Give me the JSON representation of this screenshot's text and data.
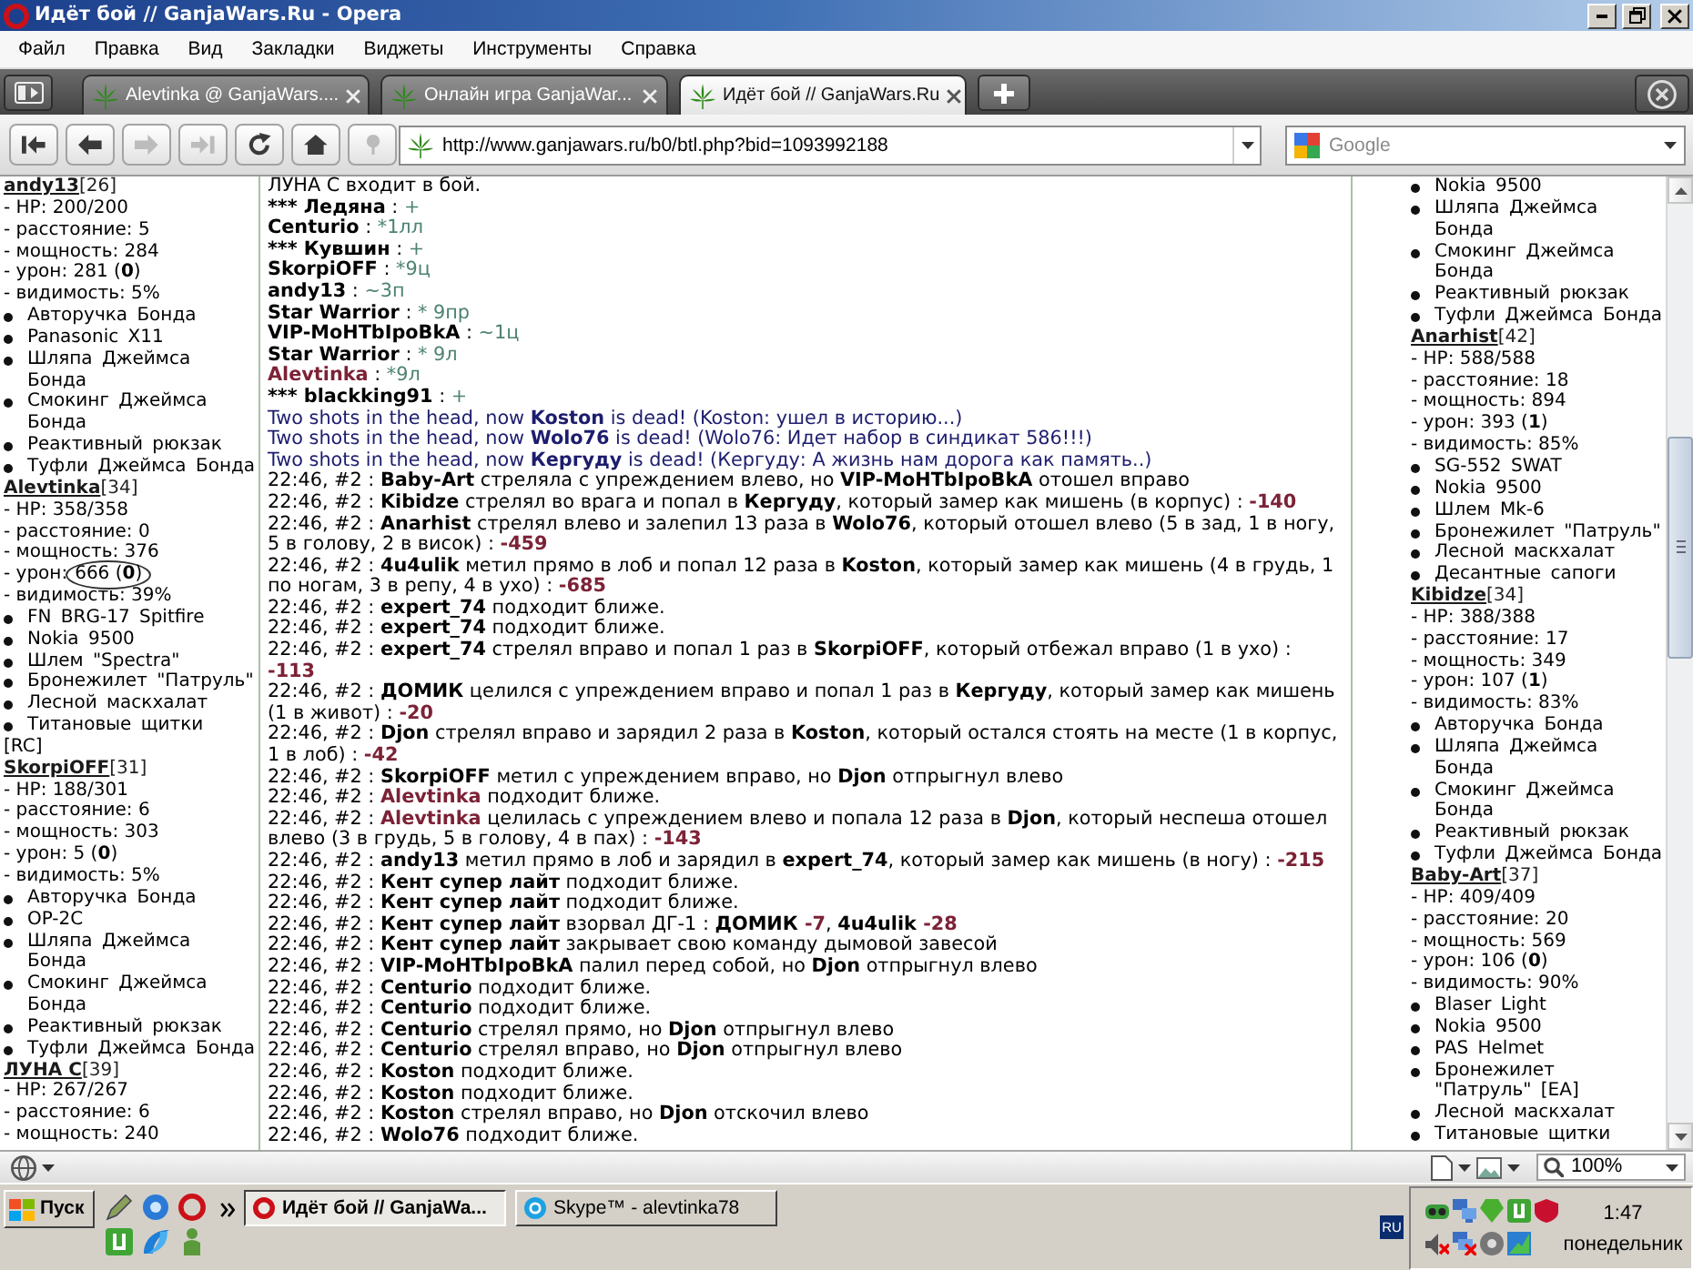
{
  "window": {
    "title": "Идёт бой // GanjaWars.Ru - Opera"
  },
  "menu": [
    "Файл",
    "Правка",
    "Вид",
    "Закладки",
    "Виджеты",
    "Инструменты",
    "Справка"
  ],
  "tabs": [
    {
      "label": "Alevtinka @ GanjaWars....",
      "selected": false
    },
    {
      "label": "Онлайн игра GanjaWar...",
      "selected": false
    },
    {
      "label": "Идёт бой // GanjaWars.Ru",
      "selected": true
    }
  ],
  "nav_buttons": [
    {
      "disabled": false
    },
    {
      "disabled": false
    },
    {
      "disabled": true
    },
    {
      "disabled": true
    },
    {
      "disabled": false
    },
    {
      "disabled": false
    },
    {
      "disabled": true
    }
  ],
  "address_bar": {
    "url": "http://www.ganjawars.ru/b0/btl.php?bid=1093992188"
  },
  "search": {
    "placeholder": "Google"
  },
  "left_team": [
    {
      "name": "andy13",
      "level": "[26]",
      "hp": "- HP: 200/200",
      "distance": "- расстояние: 5",
      "power": "- мощность: 284",
      "damage": {
        "label": "- урон:",
        "value": "281 (**0**)",
        "circled": false
      },
      "visibility": "- видимость: 5%",
      "items": [
        "Авторучка Бонда",
        "Panasonic X11",
        "Шляпа Джеймса Бонда",
        "Смокинг Джеймса Бонда",
        "Реактивный рюкзак",
        "Туфли Джеймса Бонда"
      ]
    },
    {
      "name": "Alevtinka",
      "level": "[34]",
      "hp": "- HP: 358/358",
      "distance": "- расстояние: 0",
      "power": "- мощность: 376",
      "damage": {
        "label": "- урон:",
        "value": "666 (**0**)",
        "circled": true
      },
      "visibility": "- видимость: 39%",
      "items": [
        "FN BRG-17 Spitfire",
        "Nokia 9500",
        "Шлем \"Spectra\"",
        "Бронежилет \"Патруль\"",
        "Лесной маскхалат",
        "Титановые щитки"
      ],
      "tag": "[RC]"
    },
    {
      "name": "SkorpiOFF",
      "level": "[31]",
      "hp": "- HP: 188/301",
      "distance": "- расстояние: 6",
      "power": "- мощность: 303",
      "damage": {
        "label": "- урон:",
        "value": "5 (**0**)",
        "circled": false
      },
      "visibility": "- видимость: 5%",
      "items": [
        "Авторучка Бонда",
        "OP-2C",
        "Шляпа Джеймса Бонда",
        "Смокинг Джеймса Бонда",
        "Реактивный рюкзак",
        "Туфли Джеймса Бонда"
      ]
    },
    {
      "name": "ЛУНА С",
      "level": "[39]",
      "hp": "- HP: 267/267",
      "distance": "- расстояние: 6",
      "power": "- мощность: 240"
    }
  ],
  "battle_log": [
    {
      "kind": "event",
      "segments": [
        {
          "kind": "plain",
          "text": "ЛУНА С входит в бой."
        }
      ]
    },
    {
      "kind": "chat",
      "segments": [
        {
          "kind": "name",
          "text": "*** Ледяна"
        },
        {
          "kind": "plain",
          "text": " : "
        },
        {
          "kind": "message",
          "text": "+"
        }
      ]
    },
    {
      "kind": "chat",
      "segments": [
        {
          "kind": "name",
          "text": "Centurio"
        },
        {
          "kind": "plain",
          "text": " : "
        },
        {
          "kind": "message",
          "text": "*1лл"
        }
      ]
    },
    {
      "kind": "chat",
      "segments": [
        {
          "kind": "name",
          "text": "*** Кувшин"
        },
        {
          "kind": "plain",
          "text": " : "
        },
        {
          "kind": "message",
          "text": "+"
        }
      ]
    },
    {
      "kind": "chat",
      "segments": [
        {
          "kind": "name",
          "text": "SkorpiOFF"
        },
        {
          "kind": "plain",
          "text": " : "
        },
        {
          "kind": "message",
          "text": "*9ц"
        }
      ]
    },
    {
      "kind": "chat",
      "segments": [
        {
          "kind": "name",
          "text": "andy13"
        },
        {
          "kind": "plain",
          "text": " : "
        },
        {
          "kind": "message",
          "text": "~3п"
        }
      ]
    },
    {
      "kind": "chat",
      "segments": [
        {
          "kind": "name",
          "text": "Star Warrior"
        },
        {
          "kind": "plain",
          "text": " : "
        },
        {
          "kind": "message",
          "text": "* 9пр"
        }
      ]
    },
    {
      "kind": "chat",
      "segments": [
        {
          "kind": "name",
          "text": "VIP-MoHTbIpoBkA"
        },
        {
          "kind": "plain",
          "text": " : "
        },
        {
          "kind": "message",
          "text": "~1ц"
        }
      ]
    },
    {
      "kind": "chat",
      "segments": [
        {
          "kind": "name",
          "text": "Star Warrior"
        },
        {
          "kind": "plain",
          "text": " : "
        },
        {
          "kind": "message",
          "text": "* 9л"
        }
      ]
    },
    {
      "kind": "chat",
      "segments": [
        {
          "kind": "own",
          "text": "Alevtinka"
        },
        {
          "kind": "plain",
          "text": " : "
        },
        {
          "kind": "message",
          "text": "*9л"
        }
      ]
    },
    {
      "kind": "chat",
      "segments": [
        {
          "kind": "name",
          "text": "*** blackking91"
        },
        {
          "kind": "plain",
          "text": " : "
        },
        {
          "kind": "message",
          "text": "+"
        }
      ]
    },
    {
      "kind": "death",
      "segments": [
        {
          "kind": "plain",
          "text": "Two shots in the head, now "
        },
        {
          "kind": "name",
          "text": "Koston"
        },
        {
          "kind": "plain",
          "text": " is dead! (Koston: ушел в историю...)"
        }
      ]
    },
    {
      "kind": "death",
      "segments": [
        {
          "kind": "plain",
          "text": "Two shots in the head, now "
        },
        {
          "kind": "name",
          "text": "Wolo76"
        },
        {
          "kind": "plain",
          "text": " is dead! (Wolo76: Идет набор в синдикат 586!!!)"
        }
      ]
    },
    {
      "kind": "death",
      "segments": [
        {
          "kind": "plain",
          "text": "Two shots in the head, now "
        },
        {
          "kind": "name",
          "text": "Кергуду"
        },
        {
          "kind": "plain",
          "text": " is dead! (Кергуду: А жизнь нам дорога как память..)"
        }
      ]
    },
    {
      "kind": "event",
      "segments": [
        {
          "kind": "plain",
          "text": "22:46, #2 : "
        },
        {
          "kind": "name",
          "text": "Baby-Art"
        },
        {
          "kind": "plain",
          "text": " стреляла с упреждением влево, но "
        },
        {
          "kind": "name",
          "text": "VIP-MoHTbIpoBkA"
        },
        {
          "kind": "plain",
          "text": " отошел вправо"
        }
      ]
    },
    {
      "kind": "event",
      "segments": [
        {
          "kind": "plain",
          "text": "22:46, #2 : "
        },
        {
          "kind": "name",
          "text": "Kibidze"
        },
        {
          "kind": "plain",
          "text": " стрелял во врага и попал в "
        },
        {
          "kind": "name",
          "text": "Кергуду"
        },
        {
          "kind": "plain",
          "text": ", который замер как мишень (в корпус) : "
        },
        {
          "kind": "damage",
          "text": "-140"
        }
      ]
    },
    {
      "kind": "event",
      "segments": [
        {
          "kind": "plain",
          "text": "22:46, #2 : "
        },
        {
          "kind": "name",
          "text": "Anarhist"
        },
        {
          "kind": "plain",
          "text": " стрелял влево и залепил 13 раза в "
        },
        {
          "kind": "name",
          "text": "Wolo76"
        },
        {
          "kind": "plain",
          "text": ", который отошел влево (5 в зад, 1 в ногу, 5 в голову, 2 в висок) : "
        },
        {
          "kind": "damage",
          "text": "-459"
        }
      ]
    },
    {
      "kind": "event",
      "segments": [
        {
          "kind": "plain",
          "text": "22:46, #2 : "
        },
        {
          "kind": "name",
          "text": "4u4ulik"
        },
        {
          "kind": "plain",
          "text": " метил прямо в лоб и попал 12 раза в "
        },
        {
          "kind": "name",
          "text": "Koston"
        },
        {
          "kind": "plain",
          "text": ", который замер как мишень (4 в грудь, 1 по ногам, 3 в репу, 4 в ухо) : "
        },
        {
          "kind": "damage",
          "text": "-685"
        }
      ]
    },
    {
      "kind": "event",
      "segments": [
        {
          "kind": "plain",
          "text": "22:46, #2 : "
        },
        {
          "kind": "name",
          "text": "expert_74"
        },
        {
          "kind": "plain",
          "text": " подходит ближе."
        }
      ]
    },
    {
      "kind": "event",
      "segments": [
        {
          "kind": "plain",
          "text": "22:46, #2 : "
        },
        {
          "kind": "name",
          "text": "expert_74"
        },
        {
          "kind": "plain",
          "text": " подходит ближе."
        }
      ]
    },
    {
      "kind": "event",
      "segments": [
        {
          "kind": "plain",
          "text": "22:46, #2 : "
        },
        {
          "kind": "name",
          "text": "expert_74"
        },
        {
          "kind": "plain",
          "text": " стрелял вправо и попал 1 раз в "
        },
        {
          "kind": "name",
          "text": "SkorpiOFF"
        },
        {
          "kind": "plain",
          "text": ", который отбежал вправо (1 в ухо) : "
        },
        {
          "kind": "damage",
          "text": "-113"
        }
      ]
    },
    {
      "kind": "event",
      "segments": [
        {
          "kind": "plain",
          "text": "22:46, #2 : "
        },
        {
          "kind": "name",
          "text": "ДОМИК"
        },
        {
          "kind": "plain",
          "text": " целился с упреждением вправо и попал 1 раз в "
        },
        {
          "kind": "name",
          "text": "Кергуду"
        },
        {
          "kind": "plain",
          "text": ", который замер как мишень (1 в живот) : "
        },
        {
          "kind": "damage",
          "text": "-20"
        }
      ]
    },
    {
      "kind": "event",
      "segments": [
        {
          "kind": "plain",
          "text": "22:46, #2 : "
        },
        {
          "kind": "name",
          "text": "Djon"
        },
        {
          "kind": "plain",
          "text": " стрелял вправо и зарядил 2 раза в "
        },
        {
          "kind": "name",
          "text": "Koston"
        },
        {
          "kind": "plain",
          "text": ", который остался стоять на месте (1 в корпус, 1 в лоб) : "
        },
        {
          "kind": "damage",
          "text": "-42"
        }
      ]
    },
    {
      "kind": "event",
      "segments": [
        {
          "kind": "plain",
          "text": "22:46, #2 : "
        },
        {
          "kind": "name",
          "text": "SkorpiOFF"
        },
        {
          "kind": "plain",
          "text": " метил с упреждением вправо, но "
        },
        {
          "kind": "name",
          "text": "Djon"
        },
        {
          "kind": "plain",
          "text": " отпрыгнул влево"
        }
      ]
    },
    {
      "kind": "event",
      "segments": [
        {
          "kind": "plain",
          "text": "22:46, #2 : "
        },
        {
          "kind": "own",
          "text": "Alevtinka"
        },
        {
          "kind": "plain",
          "text": " подходит ближе."
        }
      ]
    },
    {
      "kind": "event",
      "segments": [
        {
          "kind": "plain",
          "text": "22:46, #2 : "
        },
        {
          "kind": "own",
          "text": "Alevtinka"
        },
        {
          "kind": "plain",
          "text": " целилась с упреждением влево и попала 12 раза в "
        },
        {
          "kind": "name",
          "text": "Djon"
        },
        {
          "kind": "plain",
          "text": ", который неспеша отошел влево (3 в грудь, 5 в голову, 4 в пах) : "
        },
        {
          "kind": "damage",
          "text": "-143"
        }
      ]
    },
    {
      "kind": "event",
      "segments": [
        {
          "kind": "plain",
          "text": "22:46, #2 : "
        },
        {
          "kind": "name",
          "text": "andy13"
        },
        {
          "kind": "plain",
          "text": " метил прямо в лоб и зарядил в "
        },
        {
          "kind": "name",
          "text": "expert_74"
        },
        {
          "kind": "plain",
          "text": ", который замер как мишень (в ногу) : "
        },
        {
          "kind": "damage",
          "text": "-215"
        }
      ]
    },
    {
      "kind": "event",
      "segments": [
        {
          "kind": "plain",
          "text": "22:46, #2 : "
        },
        {
          "kind": "name",
          "text": "Кент супер лайт"
        },
        {
          "kind": "plain",
          "text": " подходит ближе."
        }
      ]
    },
    {
      "kind": "event",
      "segments": [
        {
          "kind": "plain",
          "text": "22:46, #2 : "
        },
        {
          "kind": "name",
          "text": "Кент супер лайт"
        },
        {
          "kind": "plain",
          "text": " подходит ближе."
        }
      ]
    },
    {
      "kind": "event",
      "segments": [
        {
          "kind": "plain",
          "text": "22:46, #2 : "
        },
        {
          "kind": "name",
          "text": "Кент супер лайт"
        },
        {
          "kind": "plain",
          "text": " взорвал ДГ-1 : "
        },
        {
          "kind": "name",
          "text": "ДОМИК"
        },
        {
          "kind": "damage",
          "text": " -7"
        },
        {
          "kind": "plain",
          "text": ", "
        },
        {
          "kind": "name",
          "text": "4u4ulik"
        },
        {
          "kind": "damage",
          "text": " -28"
        }
      ]
    },
    {
      "kind": "event",
      "segments": [
        {
          "kind": "plain",
          "text": "22:46, #2 : "
        },
        {
          "kind": "name",
          "text": "Кент супер лайт"
        },
        {
          "kind": "plain",
          "text": " закрывает свою команду дымовой завесой"
        }
      ]
    },
    {
      "kind": "event",
      "segments": [
        {
          "kind": "plain",
          "text": "22:46, #2 : "
        },
        {
          "kind": "name",
          "text": "VIP-MoHTbIpoBkA"
        },
        {
          "kind": "plain",
          "text": " палил перед собой, но "
        },
        {
          "kind": "name",
          "text": "Djon"
        },
        {
          "kind": "plain",
          "text": " отпрыгнул влево"
        }
      ]
    },
    {
      "kind": "event",
      "segments": [
        {
          "kind": "plain",
          "text": "22:46, #2 : "
        },
        {
          "kind": "name",
          "text": "Centurio"
        },
        {
          "kind": "plain",
          "text": " подходит ближе."
        }
      ]
    },
    {
      "kind": "event",
      "segments": [
        {
          "kind": "plain",
          "text": "22:46, #2 : "
        },
        {
          "kind": "name",
          "text": "Centurio"
        },
        {
          "kind": "plain",
          "text": " подходит ближе."
        }
      ]
    },
    {
      "kind": "event",
      "segments": [
        {
          "kind": "plain",
          "text": "22:46, #2 : "
        },
        {
          "kind": "name",
          "text": "Centurio"
        },
        {
          "kind": "plain",
          "text": " стрелял прямо, но "
        },
        {
          "kind": "name",
          "text": "Djon"
        },
        {
          "kind": "plain",
          "text": " отпрыгнул влево"
        }
      ]
    },
    {
      "kind": "event",
      "segments": [
        {
          "kind": "plain",
          "text": "22:46, #2 : "
        },
        {
          "kind": "name",
          "text": "Centurio"
        },
        {
          "kind": "plain",
          "text": " стрелял вправо, но "
        },
        {
          "kind": "name",
          "text": "Djon"
        },
        {
          "kind": "plain",
          "text": " отпрыгнул влево"
        }
      ]
    },
    {
      "kind": "event",
      "segments": [
        {
          "kind": "plain",
          "text": "22:46, #2 : "
        },
        {
          "kind": "name",
          "text": "Koston"
        },
        {
          "kind": "plain",
          "text": " подходит ближе."
        }
      ]
    },
    {
      "kind": "event",
      "segments": [
        {
          "kind": "plain",
          "text": "22:46, #2 : "
        },
        {
          "kind": "name",
          "text": "Koston"
        },
        {
          "kind": "plain",
          "text": " подходит ближе."
        }
      ]
    },
    {
      "kind": "event",
      "segments": [
        {
          "kind": "plain",
          "text": "22:46, #2 : "
        },
        {
          "kind": "name",
          "text": "Koston"
        },
        {
          "kind": "plain",
          "text": " стрелял вправо, но "
        },
        {
          "kind": "name",
          "text": "Djon"
        },
        {
          "kind": "plain",
          "text": " отскочил влево"
        }
      ]
    },
    {
      "kind": "event",
      "segments": [
        {
          "kind": "plain",
          "text": "22:46, #2 : "
        },
        {
          "kind": "name",
          "text": "Wolo76"
        },
        {
          "kind": "plain",
          "text": " подходит ближе."
        }
      ]
    }
  ],
  "right_team": [
    {
      "items": [
        "Nokia 9500",
        "Шляпа Джеймса Бонда",
        "Смокинг Джеймса Бонда",
        "Реактивный рюкзак",
        "Туфли Джеймса Бонда"
      ]
    },
    {
      "name": "Anarhist",
      "level": "[42]",
      "hp": "- HP: 588/588",
      "distance": "- расстояние: 18",
      "power": "- мощность: 894",
      "damage": {
        "label": "- урон:",
        "value": "393 (**1**)",
        "circled": false
      },
      "visibility": "- видимость: 85%",
      "items": [
        "SG-552 SWAT",
        "Nokia 9500",
        "Шлем Mk-6",
        "Бронежилет \"Патруль\"",
        "Лесной маскхалат",
        "Десантные сапоги"
      ]
    },
    {
      "name": "Kibidze",
      "level": "[34]",
      "hp": "- HP: 388/388",
      "distance": "- расстояние: 17",
      "power": "- мощность: 349",
      "damage": {
        "label": "- урон:",
        "value": "107 (**1**)",
        "circled": false
      },
      "visibility": "- видимость: 83%",
      "items": [
        "Авторучка Бонда",
        "Шляпа Джеймса Бонда",
        "Смокинг Джеймса Бонда",
        "Реактивный рюкзак",
        "Туфли Джеймса Бонда"
      ]
    },
    {
      "name": "Baby-Art",
      "level": "[37]",
      "hp": "- HP: 409/409",
      "distance": "- расстояние: 20",
      "power": "- мощность: 569",
      "damage": {
        "label": "- урон:",
        "value": "106 (**0**)",
        "circled": false
      },
      "visibility": "- видимость: 90%",
      "items": [
        "Blaser Light",
        "Nokia 9500",
        "PAS Helmet",
        "Бронежилет \"Патруль\" [EA]",
        "Лесной маскхалат",
        "Титановые щитки"
      ]
    }
  ],
  "status_bar": {
    "zoom": "100%"
  },
  "taskbar": {
    "start": "Пуск",
    "tasks": [
      {
        "label": "Идёт бой // GanjaWa...",
        "selected": true
      },
      {
        "label": "Skype™ - alevtinka78",
        "selected": false
      }
    ],
    "language": "RU",
    "clock": {
      "time": "1:47",
      "day": "понедельник"
    }
  }
}
